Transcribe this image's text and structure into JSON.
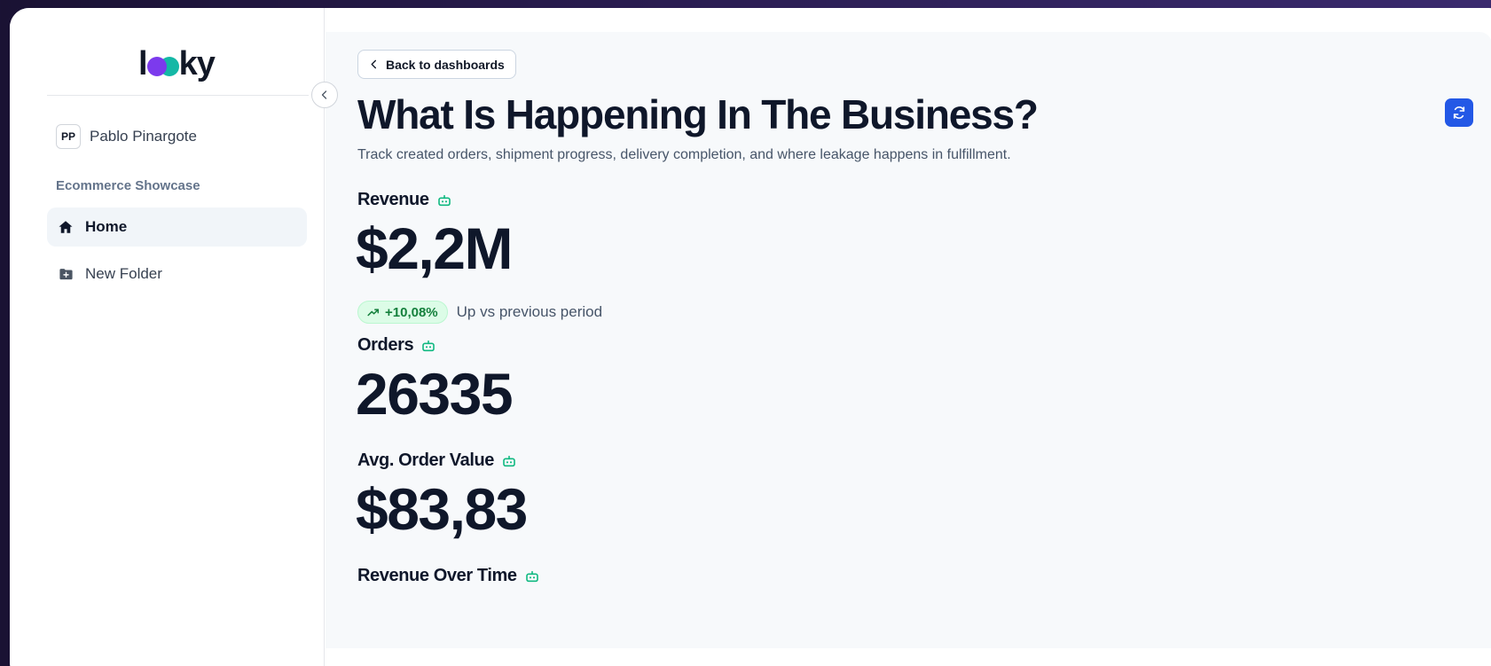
{
  "sidebar": {
    "logo": {
      "text_l": "l",
      "text_rest": "ky"
    },
    "user": {
      "initials": "PP",
      "name": "Pablo Pinargote"
    },
    "section": "Ecommerce Showcase",
    "items": [
      {
        "label": "Home",
        "icon": "home-icon",
        "active": true
      },
      {
        "label": "New Folder",
        "icon": "folder-plus-icon",
        "active": false
      }
    ]
  },
  "header": {
    "back_label": "Back to dashboards",
    "title": "What Is Happening In The Business?",
    "subtitle": "Track created orders, shipment progress, delivery completion, and where leakage happens in fulfillment."
  },
  "metrics": {
    "revenue": {
      "label": "Revenue",
      "value": "$2,2M",
      "delta": "+10,08%",
      "delta_text": "Up vs previous period"
    },
    "orders": {
      "label": "Orders",
      "value": "26335"
    },
    "aov": {
      "label": "Avg. Order Value",
      "value": "$83,83"
    },
    "revenue_over_time": {
      "label": "Revenue Over Time"
    }
  },
  "colors": {
    "accent": "#2358e6",
    "positive": "#15803d",
    "ai_icon": "#10b981"
  }
}
